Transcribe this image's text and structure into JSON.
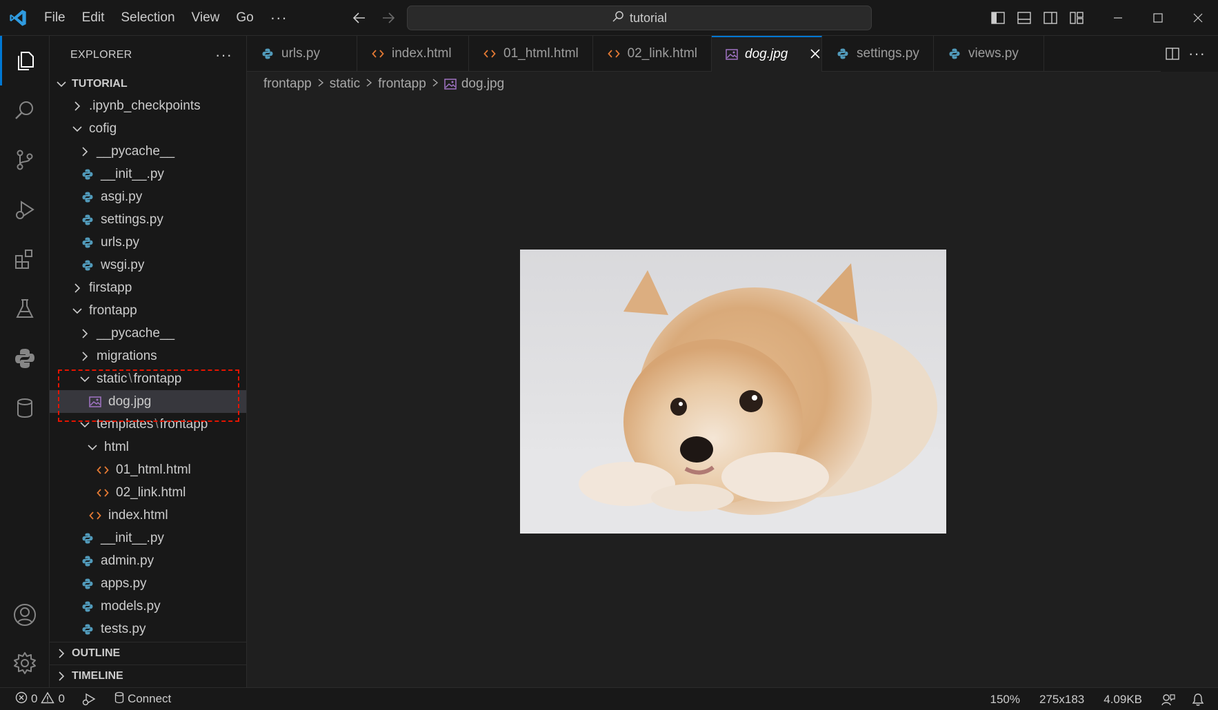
{
  "app": {
    "search_text": "tutorial",
    "accent_color": "#0078d4"
  },
  "menu": [
    "File",
    "Edit",
    "Selection",
    "View",
    "Go",
    "···"
  ],
  "sidebar": {
    "title": "EXPLORER",
    "more": "···",
    "root": "TUTORIAL",
    "tree": [
      {
        "label": ".ipynb_checkpoints",
        "depth": 1,
        "kind": "folder",
        "expanded": false
      },
      {
        "label": "cofig",
        "depth": 1,
        "kind": "folder",
        "expanded": true
      },
      {
        "label": "__pycache__",
        "depth": 2,
        "kind": "folder",
        "expanded": false
      },
      {
        "label": "__init__.py",
        "depth": 2,
        "kind": "python"
      },
      {
        "label": "asgi.py",
        "depth": 2,
        "kind": "python"
      },
      {
        "label": "settings.py",
        "depth": 2,
        "kind": "python"
      },
      {
        "label": "urls.py",
        "depth": 2,
        "kind": "python"
      },
      {
        "label": "wsgi.py",
        "depth": 2,
        "kind": "python"
      },
      {
        "label": "firstapp",
        "depth": 1,
        "kind": "folder",
        "expanded": false
      },
      {
        "label": "frontapp",
        "depth": 1,
        "kind": "folder",
        "expanded": true
      },
      {
        "label": "__pycache__",
        "depth": 2,
        "kind": "folder",
        "expanded": false
      },
      {
        "label": "migrations",
        "depth": 2,
        "kind": "folder",
        "expanded": false
      },
      {
        "label": "static",
        "label2": "frontapp",
        "depth": 2,
        "kind": "folder",
        "expanded": true
      },
      {
        "label": "dog.jpg",
        "depth": 3,
        "kind": "image",
        "selected": true
      },
      {
        "label": "templates",
        "label2": "frontapp",
        "depth": 2,
        "kind": "folder",
        "expanded": true
      },
      {
        "label": "html",
        "depth": 3,
        "kind": "folder",
        "expanded": true
      },
      {
        "label": "01_html.html",
        "depth": 4,
        "kind": "html"
      },
      {
        "label": "02_link.html",
        "depth": 4,
        "kind": "html"
      },
      {
        "label": "index.html",
        "depth": 3,
        "kind": "html"
      },
      {
        "label": "__init__.py",
        "depth": 2,
        "kind": "python"
      },
      {
        "label": "admin.py",
        "depth": 2,
        "kind": "python"
      },
      {
        "label": "apps.py",
        "depth": 2,
        "kind": "python"
      },
      {
        "label": "models.py",
        "depth": 2,
        "kind": "python"
      },
      {
        "label": "tests.py",
        "depth": 2,
        "kind": "python"
      }
    ],
    "outline": "OUTLINE",
    "timeline": "TIMELINE"
  },
  "tabs": [
    {
      "label": "urls.py",
      "kind": "python"
    },
    {
      "label": "index.html",
      "kind": "html"
    },
    {
      "label": "01_html.html",
      "kind": "html"
    },
    {
      "label": "02_link.html",
      "kind": "html"
    },
    {
      "label": "dog.jpg",
      "kind": "image",
      "active": true
    },
    {
      "label": "settings.py",
      "kind": "python"
    },
    {
      "label": "views.py",
      "kind": "python"
    }
  ],
  "breadcrumb": [
    "frontapp",
    "static",
    "frontapp",
    "dog.jpg"
  ],
  "status": {
    "errors": "0",
    "warnings": "0",
    "connect": "Connect",
    "zoom": "150%",
    "dimensions": "275x183",
    "filesize": "4.09KB"
  },
  "colors": {
    "python_icon": "#519aba",
    "html_icon": "#e37933",
    "image_icon": "#a074c4",
    "selection_box": "#e51400"
  }
}
